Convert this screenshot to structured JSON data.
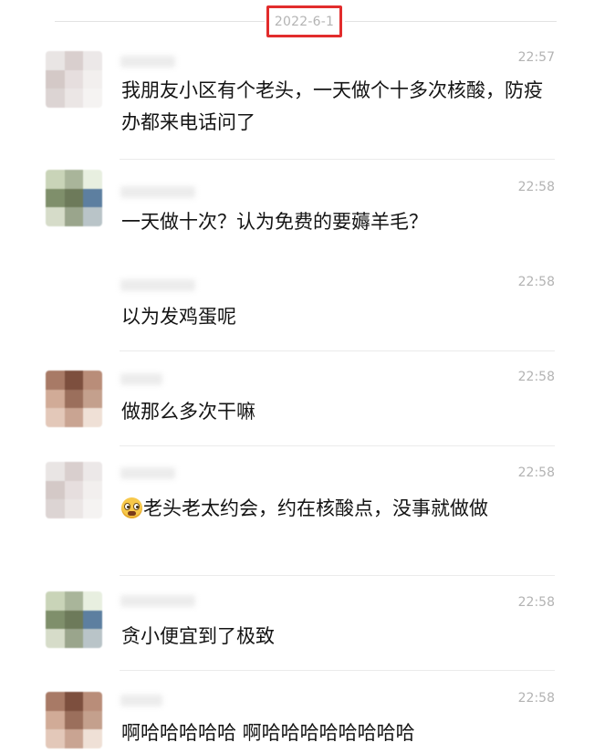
{
  "date": "2022-6-1",
  "messages": [
    {
      "time": "22:57",
      "text": "我朋友小区有个老头，一天做个十多次核酸，防疫办都来电话问了",
      "emoji": ""
    },
    {
      "time": "22:58",
      "text": "一天做十次？认为免费的要薅羊毛？",
      "emoji": ""
    },
    {
      "time": "22:58",
      "text": "以为发鸡蛋呢",
      "emoji": ""
    },
    {
      "time": "22:58",
      "text": "做那么多次干嘛",
      "emoji": ""
    },
    {
      "time": "22:58",
      "text": "老头老太约会，约在核酸点，没事就做做",
      "emoji": "flushed-emoji"
    },
    {
      "time": "22:58",
      "text": "贪小便宜到了极致",
      "emoji": ""
    },
    {
      "time": "22:58",
      "text": "啊哈哈哈哈哈 啊哈哈哈哈哈哈哈哈",
      "emoji": ""
    }
  ],
  "avatar_colors": {
    "a": [
      "#e9e5e4",
      "#d9cfce",
      "#ece8e8",
      "#d4c9c7",
      "#e6dede",
      "#f2efee",
      "#dcd4d3",
      "#ebe6e5",
      "#f5f3f2"
    ],
    "b": [
      "#c9d4b8",
      "#a9b59a",
      "#e8efe0",
      "#7f8f6b",
      "#6d7a5a",
      "#5d7fa0",
      "#d6dcc9",
      "#9aa58c",
      "#b9c4c8"
    ],
    "c": [
      "#a87a66",
      "#7d4f3e",
      "#b98d79",
      "#d1ab97",
      "#9b6f5c",
      "#c4a08d",
      "#e3c8b9",
      "#c9a492",
      "#efe0d6"
    ]
  }
}
